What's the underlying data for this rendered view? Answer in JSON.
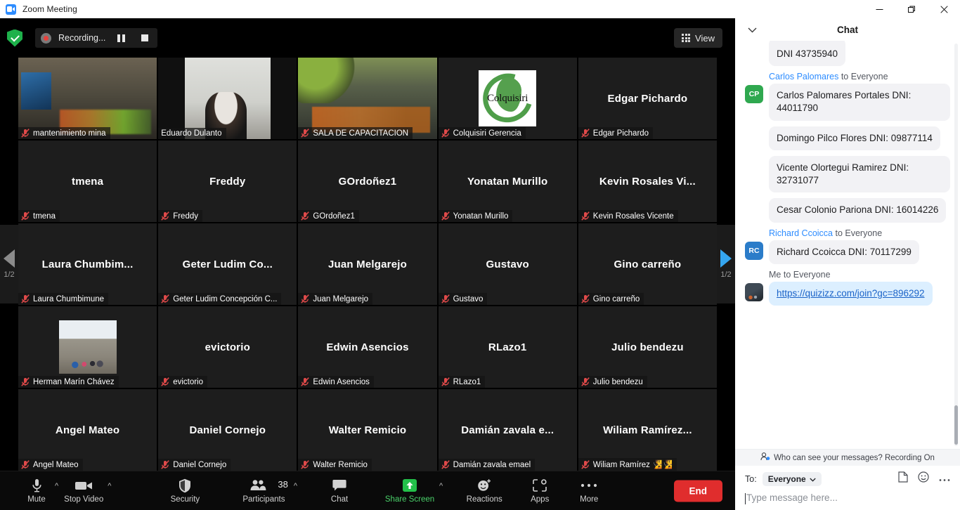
{
  "window": {
    "title": "Zoom Meeting",
    "app_icon": "zoom-camera-icon",
    "controls": {
      "minimize": "—",
      "restore": "❐",
      "close": "✕"
    }
  },
  "stage_top": {
    "security_shield_icon": "shield-check-icon",
    "recording_label": "Recording...",
    "record_dot_icon": "record-dot-icon",
    "pause_icon": "pause-icon",
    "stop_icon": "stop-icon",
    "view_label": "View",
    "view_icon": "grid-view-icon"
  },
  "pager": {
    "left_icon": "chevron-left-triangle-icon",
    "right_icon": "chevron-right-triangle-icon",
    "left_page": "1/2",
    "right_page": "1/2"
  },
  "tiles": [
    {
      "id": 1,
      "display_name": "mantenimiento mina",
      "name_label": "mantenimiento mina",
      "kind": "video",
      "video": "vid-a",
      "muted": true,
      "active_speaker": false
    },
    {
      "id": 2,
      "display_name": "Eduardo Dulanto",
      "name_label": "Eduardo Dulanto",
      "kind": "video",
      "video": "vid-b",
      "muted": false,
      "active_speaker": true
    },
    {
      "id": 3,
      "display_name": "SALA DE CAPACITACION",
      "name_label": "SALA DE CAPACITACION",
      "kind": "video",
      "video": "vid-c",
      "muted": true,
      "active_speaker": false
    },
    {
      "id": 4,
      "display_name": "Colquisiri Gerencia",
      "name_label": "Colquisiri Gerencia",
      "kind": "logo",
      "logo_text": "Colquisiri",
      "muted": true,
      "active_speaker": false
    },
    {
      "id": 5,
      "display_name": "Edgar Pichardo",
      "name_label": "Edgar Pichardo",
      "kind": "name",
      "muted": true,
      "active_speaker": false
    },
    {
      "id": 6,
      "display_name": "tmena",
      "name_label": "tmena",
      "kind": "name",
      "muted": true,
      "active_speaker": false
    },
    {
      "id": 7,
      "display_name": "Freddy",
      "name_label": "Freddy",
      "kind": "name",
      "muted": true,
      "active_speaker": false
    },
    {
      "id": 8,
      "display_name": "GOrdoñez1",
      "name_label": "GOrdoñez1",
      "kind": "name",
      "muted": true,
      "active_speaker": false
    },
    {
      "id": 9,
      "display_name": "Yonatan Murillo",
      "name_label": "Yonatan Murillo",
      "kind": "name",
      "muted": true,
      "active_speaker": false
    },
    {
      "id": 10,
      "display_name": "Kevin Rosales Vi...",
      "name_label": "Kevin Rosales Vicente",
      "kind": "name",
      "muted": true,
      "active_speaker": false
    },
    {
      "id": 11,
      "display_name": "Laura  Chumbim...",
      "name_label": "Laura Chumbimune",
      "kind": "name",
      "muted": true,
      "active_speaker": false
    },
    {
      "id": 12,
      "display_name": "Geter Ludim  Co...",
      "name_label": "Geter Ludim Concepción C...",
      "kind": "name",
      "muted": true,
      "active_speaker": false
    },
    {
      "id": 13,
      "display_name": "Juan Melgarejo",
      "name_label": "Juan Melgarejo",
      "kind": "name",
      "muted": true,
      "active_speaker": false
    },
    {
      "id": 14,
      "display_name": "Gustavo",
      "name_label": "Gustavo",
      "kind": "name",
      "muted": true,
      "active_speaker": false
    },
    {
      "id": 15,
      "display_name": "Gino carreño",
      "name_label": "Gino carreño",
      "kind": "name",
      "muted": true,
      "active_speaker": false
    },
    {
      "id": 16,
      "display_name": "Herman  Marín Chávez",
      "name_label": "Herman  Marín Chávez",
      "kind": "avatar",
      "muted": true,
      "active_speaker": false
    },
    {
      "id": 17,
      "display_name": "evictorio",
      "name_label": "evictorio",
      "kind": "name",
      "muted": true,
      "active_speaker": false
    },
    {
      "id": 18,
      "display_name": "Edwin Asencios",
      "name_label": "Edwin Asencios",
      "kind": "name",
      "muted": true,
      "active_speaker": false
    },
    {
      "id": 19,
      "display_name": "RLazo1",
      "name_label": "RLazo1",
      "kind": "name",
      "muted": true,
      "active_speaker": false
    },
    {
      "id": 20,
      "display_name": "Julio bendezu",
      "name_label": "Julio bendezu",
      "kind": "name",
      "muted": true,
      "active_speaker": false
    },
    {
      "id": 21,
      "display_name": "Angel Mateo",
      "name_label": "Angel Mateo",
      "kind": "name",
      "muted": true,
      "active_speaker": false
    },
    {
      "id": 22,
      "display_name": "Daniel Cornejo",
      "name_label": "Daniel Cornejo",
      "kind": "name",
      "muted": true,
      "active_speaker": false
    },
    {
      "id": 23,
      "display_name": "Walter Remicio",
      "name_label": "Walter Remicio",
      "kind": "name",
      "muted": true,
      "active_speaker": false
    },
    {
      "id": 24,
      "display_name": "Damián  zavala  e...",
      "name_label": "Damián zavala emael",
      "kind": "name",
      "muted": true,
      "active_speaker": false
    },
    {
      "id": 25,
      "display_name": "Wiliam  Ramírez...",
      "name_label": "Wiliam Ramírez 🧏🧏",
      "kind": "name",
      "muted": true,
      "active_speaker": false
    }
  ],
  "toolbar": {
    "mute_label": "Mute",
    "mute_icon": "microphone-icon",
    "stop_video_label": "Stop Video",
    "stop_video_icon": "camera-icon",
    "security_label": "Security",
    "security_icon": "shield-icon",
    "participants_label": "Participants",
    "participants_icon": "people-icon",
    "participants_count": "38",
    "chat_label": "Chat",
    "chat_icon": "speech-bubble-icon",
    "share_screen_label": "Share Screen",
    "share_screen_icon": "share-arrow-up-icon",
    "reactions_label": "Reactions",
    "reactions_icon": "smiley-plus-icon",
    "apps_label": "Apps",
    "apps_icon": "apps-bracket-icon",
    "more_label": "More",
    "more_icon": "ellipsis-icon",
    "end_label": "End",
    "caret_icon": "chevron-up-icon"
  },
  "chat": {
    "title": "Chat",
    "collapse_icon": "chevron-down-icon",
    "messages": [
      {
        "type": "bubble",
        "sender": null,
        "avatar": null,
        "text": "DNI\n43735940",
        "cut_top": true
      },
      {
        "type": "header",
        "sender": "Carlos Palomares",
        "to": "to Everyone"
      },
      {
        "type": "bubble",
        "sender": "Carlos Palomares",
        "avatar_initials": "CP",
        "avatar_color": "#2fa84f",
        "text": "Carlos Palomares Portales DNI: 44011790"
      },
      {
        "type": "bubble",
        "sender": null,
        "avatar": null,
        "text": "Domingo Pilco Flores DNI: 09877114"
      },
      {
        "type": "bubble",
        "sender": null,
        "avatar": null,
        "text": "Vicente Olortegui Ramirez DNI: 32731077"
      },
      {
        "type": "bubble",
        "sender": null,
        "avatar": null,
        "text": "Cesar Colonio Pariona DNI: 16014226"
      },
      {
        "type": "header",
        "sender": "Richard Ccoicca",
        "to": "to Everyone"
      },
      {
        "type": "bubble",
        "sender": "Richard Ccoicca",
        "avatar_initials": "RC",
        "avatar_color": "#2b7cc9",
        "text": "Richard Ccoicca DNI: 70117299"
      },
      {
        "type": "header",
        "sender": "Me",
        "to": "to Everyone",
        "is_me": true
      },
      {
        "type": "link",
        "sender": "Me",
        "avatar_image": true,
        "text": "https://quizizz.com/join?gc=896292"
      }
    ],
    "privacy_notice": "Who can see your messages? Recording On",
    "privacy_icon": "person-add-icon",
    "compose": {
      "to_label": "To:",
      "to_value": "Everyone",
      "to_caret_icon": "chevron-down-icon",
      "file_icon": "file-icon",
      "emoji_icon": "smiley-icon",
      "more_icon": "ellipsis-icon",
      "placeholder": "Type message here..."
    }
  },
  "colors": {
    "accent_blue": "#2d8cff",
    "active_speaker": "#f2f467",
    "end_red": "#e02d2d",
    "share_green": "#4ad16a",
    "pager_right": "#35a6f0"
  }
}
